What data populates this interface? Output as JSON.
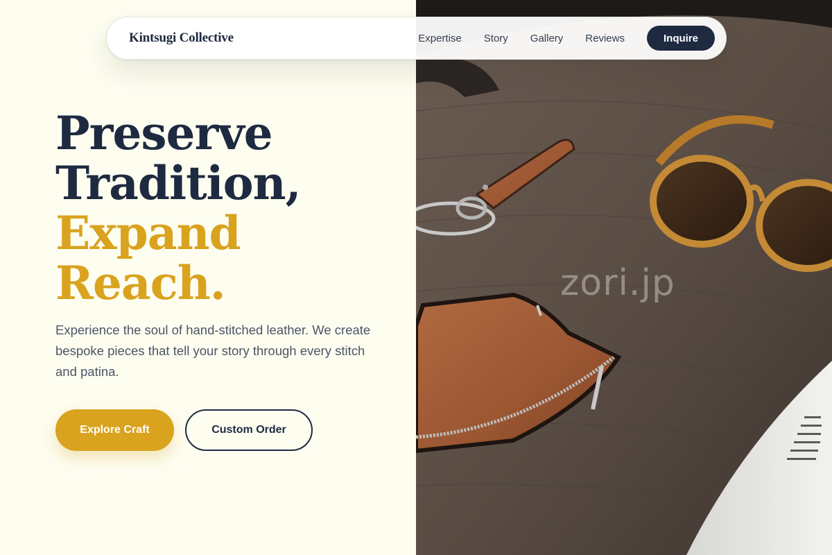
{
  "nav": {
    "brand": "Kintsugi Collective",
    "links": [
      "Expertise",
      "Story",
      "Gallery",
      "Reviews"
    ],
    "cta_label": "Inquire"
  },
  "hero": {
    "title_lines": [
      "Preserve",
      "Tradition,",
      "Expand",
      "Reach."
    ],
    "description": "Experience the soul of hand-stitched leather. We create bespoke pieces that tell your story through every stitch and patina.",
    "primary_button": "Explore Craft",
    "secondary_button": "Custom Order"
  },
  "photo": {
    "watermark": "zori.jp",
    "subject": "leather wallet, key strap and sunglasses on wooden table"
  },
  "colors": {
    "background": "#fdfdf0",
    "navy": "#1e2a40",
    "gold": "#d9a31f",
    "body_text": "#4d5566"
  }
}
